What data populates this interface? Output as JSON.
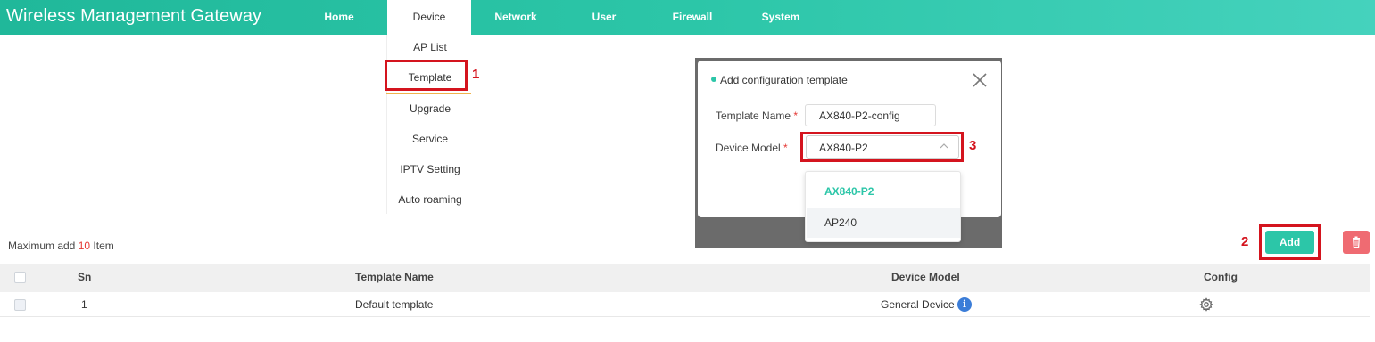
{
  "header": {
    "title": "Wireless Management Gateway",
    "nav": [
      "Home",
      "Device",
      "Network",
      "User",
      "Firewall",
      "System"
    ],
    "active_nav": "Device"
  },
  "device_menu": {
    "items": [
      "AP List",
      "Template",
      "Upgrade",
      "Service",
      "IPTV Setting",
      "Auto roaming"
    ],
    "highlighted": "Template"
  },
  "annotations": {
    "step1": "1",
    "step2": "2",
    "step3": "3"
  },
  "modal": {
    "title": "Add configuration template",
    "template_name_label": "Template Name",
    "device_model_label": "Device Model",
    "required_mark": "*",
    "template_name_value": "AX840-P2-config",
    "device_model_value": "AX840-P2",
    "device_model_options": [
      "AX840-P2",
      "AP240"
    ]
  },
  "toolbar": {
    "max_prefix": "Maximum add",
    "max_count": "10",
    "max_suffix": "Item",
    "add_label": "Add"
  },
  "table": {
    "columns": [
      "Sn",
      "Template Name",
      "Device Model",
      "Config"
    ],
    "rows": [
      {
        "sn": "1",
        "template_name": "Default template",
        "device_model": "General Device"
      }
    ]
  },
  "colors": {
    "accent": "#2cc6a8",
    "highlight_red": "#d4141e",
    "delete_button": "#ef6b72",
    "info_blue": "#3b7dd8"
  },
  "icons": {
    "modal_close": "close-icon",
    "select_arrow": "chevron-up-icon",
    "delete": "trash-icon",
    "info": "info-icon",
    "config": "gear-icon"
  }
}
